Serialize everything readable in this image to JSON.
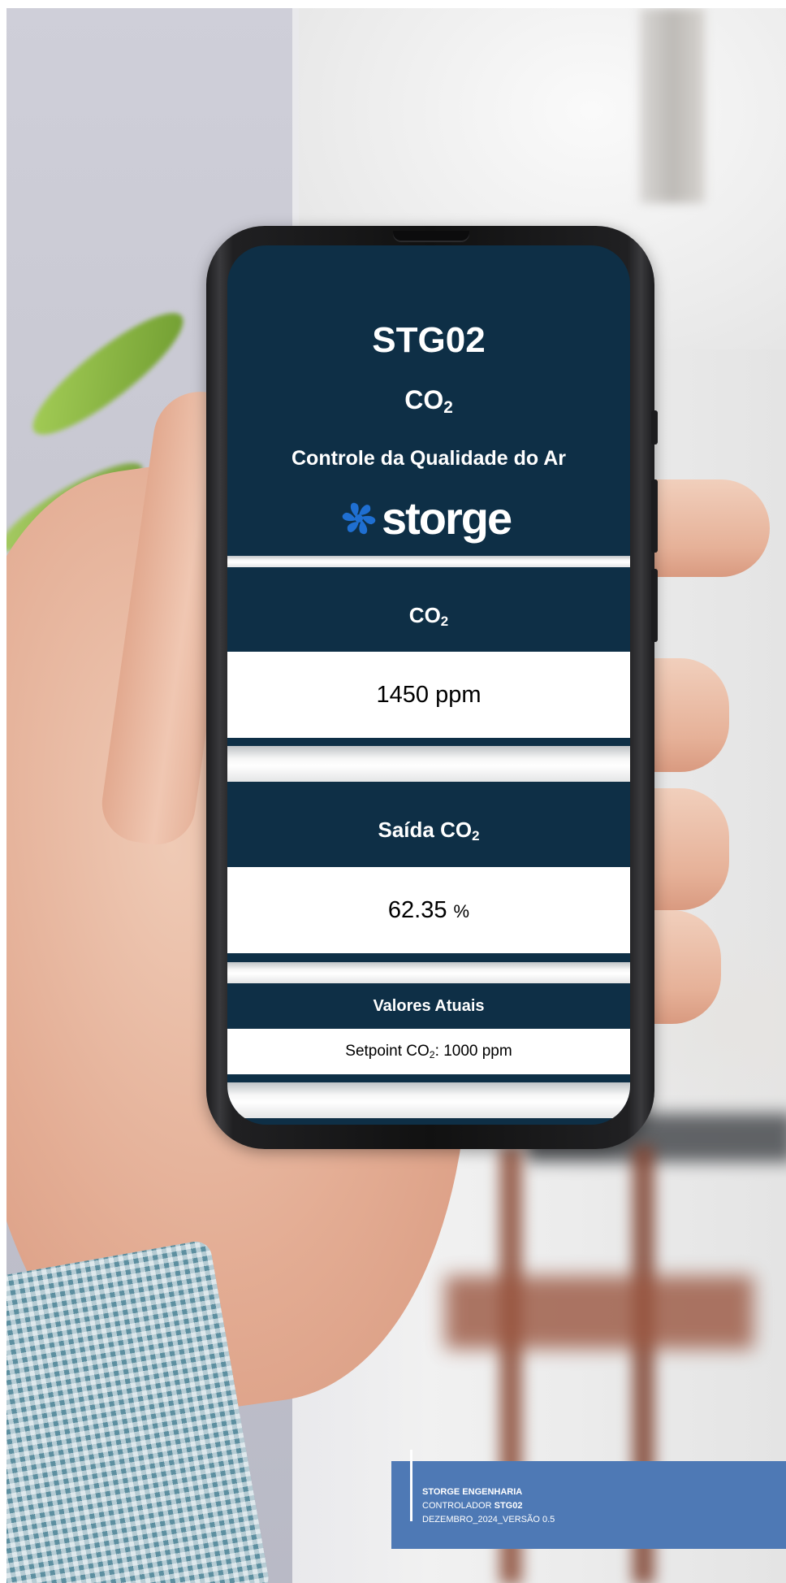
{
  "app": {
    "title": "STG02",
    "gas": "CO",
    "gas_sub": "2",
    "subtitle": "Controle da Qualidade do Ar",
    "logo_text": "storge"
  },
  "sections": {
    "co2": {
      "label": "CO",
      "label_sub": "2",
      "value": "1450 ppm"
    },
    "output": {
      "label": "Saída CO",
      "label_sub": "2",
      "value": "62.35",
      "unit": "%"
    },
    "current": {
      "header": "Valores Atuais",
      "setpoint_prefix": "Setpoint CO",
      "setpoint_sub": "2",
      "setpoint_suffix": ": 1000 ppm"
    }
  },
  "footer": {
    "company": "STORGE ENGENHARIA",
    "controller_prefix": "CONTROLADOR ",
    "controller_model": "STG02",
    "version": "DEZEMBRO_2024_VERSÃO 0.5"
  },
  "colors": {
    "screen_bg": "#0e2f46",
    "footer_bg": "#4e79b5",
    "logo_icon": "#1f6fd1"
  },
  "icons": [
    "fan-logo-icon"
  ]
}
